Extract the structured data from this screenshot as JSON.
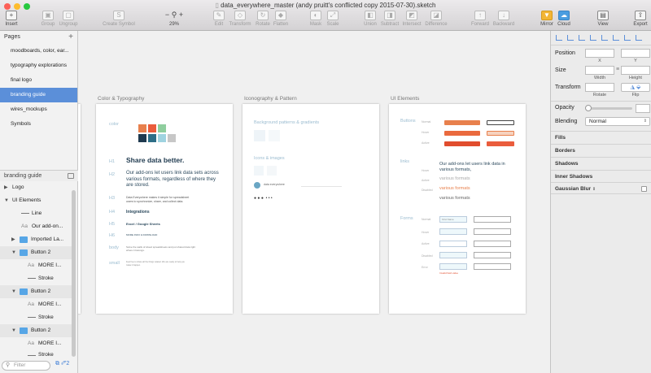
{
  "window": {
    "title": "data_everywhere_master (andy pruitt's conflicted copy 2015-07-30).sketch"
  },
  "toolbar": {
    "insert": "Insert",
    "group": "Group",
    "ungroup": "Ungroup",
    "create_symbol": "Create Symbol",
    "zoom": "29%",
    "edit": "Edit",
    "transform": "Transform",
    "rotate": "Rotate",
    "flatten": "Flatten",
    "mask": "Mask",
    "scale": "Scale",
    "union": "Union",
    "subtract": "Subtract",
    "intersect": "Intersect",
    "difference": "Difference",
    "forward": "Forward",
    "backward": "Backward",
    "mirror": "Mirror",
    "cloud": "Cloud",
    "view": "View",
    "export": "Export"
  },
  "pages": {
    "header": "Pages",
    "items": [
      "moodboards, color, ear...",
      "typography explorations",
      "final logo",
      "branding guide",
      "wires_mockups",
      "Symbols"
    ],
    "selected_index": 3
  },
  "layers": {
    "header": "branding guide",
    "items": [
      "Logo",
      "UI Elements",
      "Line",
      "Our add-on...",
      "Imported La...",
      "Button 2",
      "MORE I...",
      "Stroke",
      "Button 2",
      "MORE I...",
      "Stroke",
      "Button 2",
      "MORE I...",
      "Stroke"
    ],
    "filter_placeholder": "Filter",
    "count": "2"
  },
  "canvas": {
    "artboards": [
      "Color & Typography",
      "Iconography & Pattern",
      "UI Elements"
    ],
    "typo": {
      "color_label": "color",
      "h1_tag": "H1",
      "h1": "Share data better.",
      "h2_tag": "H2",
      "h2": "Our add-ons let users link data sets across various formats, regardless of where they are stored.",
      "h3_tag": "H3",
      "h3": "Data Everywhere makes it simple for spreadsheet users to synchronize, share, and collect data.",
      "h4_tag": "H4",
      "h4": "Integrations",
      "h5_tag": "H5",
      "h5": "Excel / Google Sheets",
      "h6_tag": "H6",
      "h6": "MORE INFO & DOWNLOAD",
      "body_tag": "body",
      "body": "Solve the walls of siloed spreadsheets and put shared data right where it belongs.",
      "small_tag": "small",
      "small": "Feel free to share all the things related. We are ready to help you make it happen."
    },
    "icon": {
      "patterns": "Background patterns & gradients",
      "icons": "Icons & images",
      "logo_text": "data everywhere"
    },
    "ui": {
      "buttons": "Buttons",
      "links": "links",
      "forms": "Forms",
      "states": [
        "Normal",
        "Hover",
        "Active",
        "Disabled",
        "Error"
      ],
      "btn_text": "MORE INFO & DOWNLOAD",
      "link_text": "Our add-ons let users link data in various formats,",
      "link_states": [
        "various formats",
        "various formats",
        "various formats"
      ],
      "input_ph": "First Name",
      "select_ph": "Select an option",
      "error_msg": "Invalid field value"
    },
    "swatches": [
      "#e8804d",
      "#ea5c3c",
      "#8fce9e",
      "#bfe2c3",
      "#1f3a4f",
      "#2d6e87",
      "#9fd3e0",
      "#c7c7c7"
    ]
  },
  "inspector": {
    "position": "Position",
    "x": "X",
    "y": "Y",
    "size": "Size",
    "width": "Width",
    "height": "Height",
    "transform": "Transform",
    "rotate": "Rotate",
    "flip": "Flip",
    "opacity": "Opacity",
    "blending": "Blending",
    "blending_value": "Normal",
    "sections": [
      "Fills",
      "Borders",
      "Shadows",
      "Inner Shadows",
      "Gaussian Blur"
    ]
  }
}
